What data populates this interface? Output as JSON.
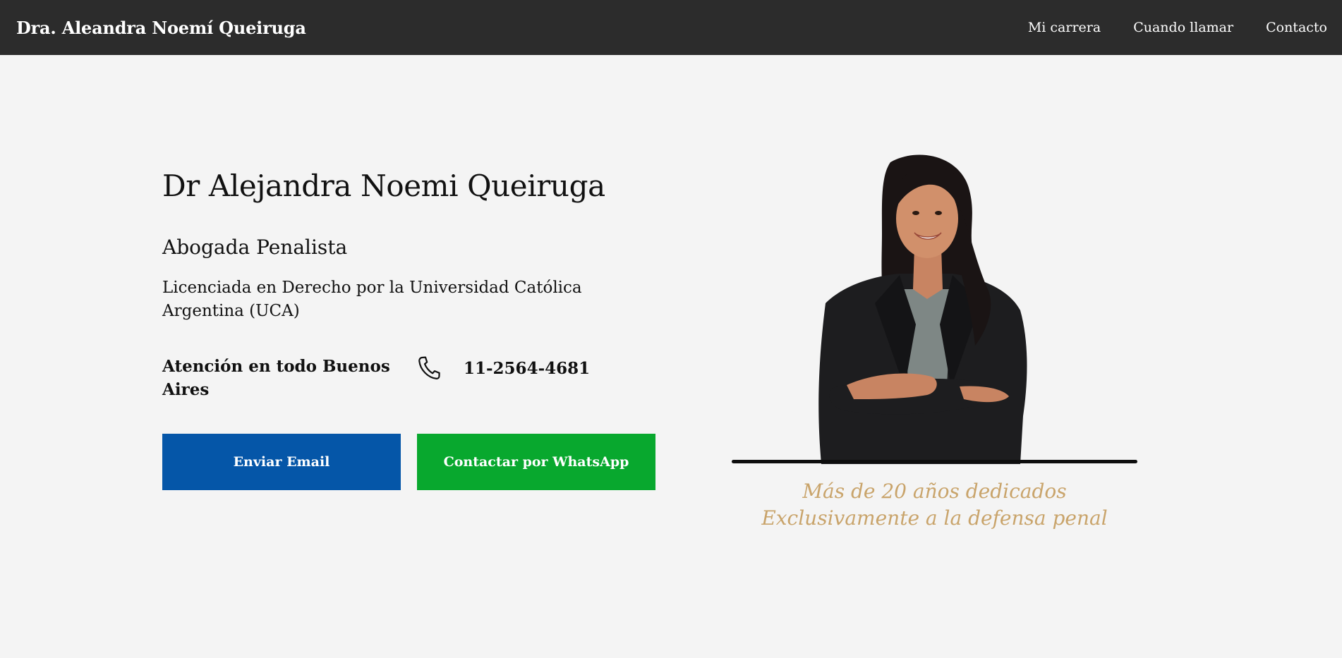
{
  "navbar": {
    "brand": "Dra. Aleandra Noemí Queiruga",
    "links": [
      {
        "label": "Mi carrera"
      },
      {
        "label": "Cuando llamar"
      },
      {
        "label": "Contacto"
      }
    ]
  },
  "hero": {
    "title": "Dr Alejandra Noemi Queiruga",
    "subtitle": "Abogada Penalista",
    "description": "Licenciada en Derecho por la Universidad Católica Argentina (UCA)",
    "coverage": "Atención en todo Buenos Aires",
    "phone": "11-2564-4681",
    "buttons": {
      "email": "Enviar Email",
      "whatsapp": "Contactar por WhatsApp"
    }
  },
  "portrait": {
    "tagline_line1": "Más de 20 años dedicados",
    "tagline_line2": "Exclusivamente a la defensa penal"
  },
  "colors": {
    "navbar_bg": "#2c2c2c",
    "page_bg": "#f4f4f4",
    "email_button": "#0556a8",
    "whatsapp_button": "#08a82e",
    "tagline": "#c9a46b"
  },
  "icons": {
    "phone": "phone-icon"
  }
}
